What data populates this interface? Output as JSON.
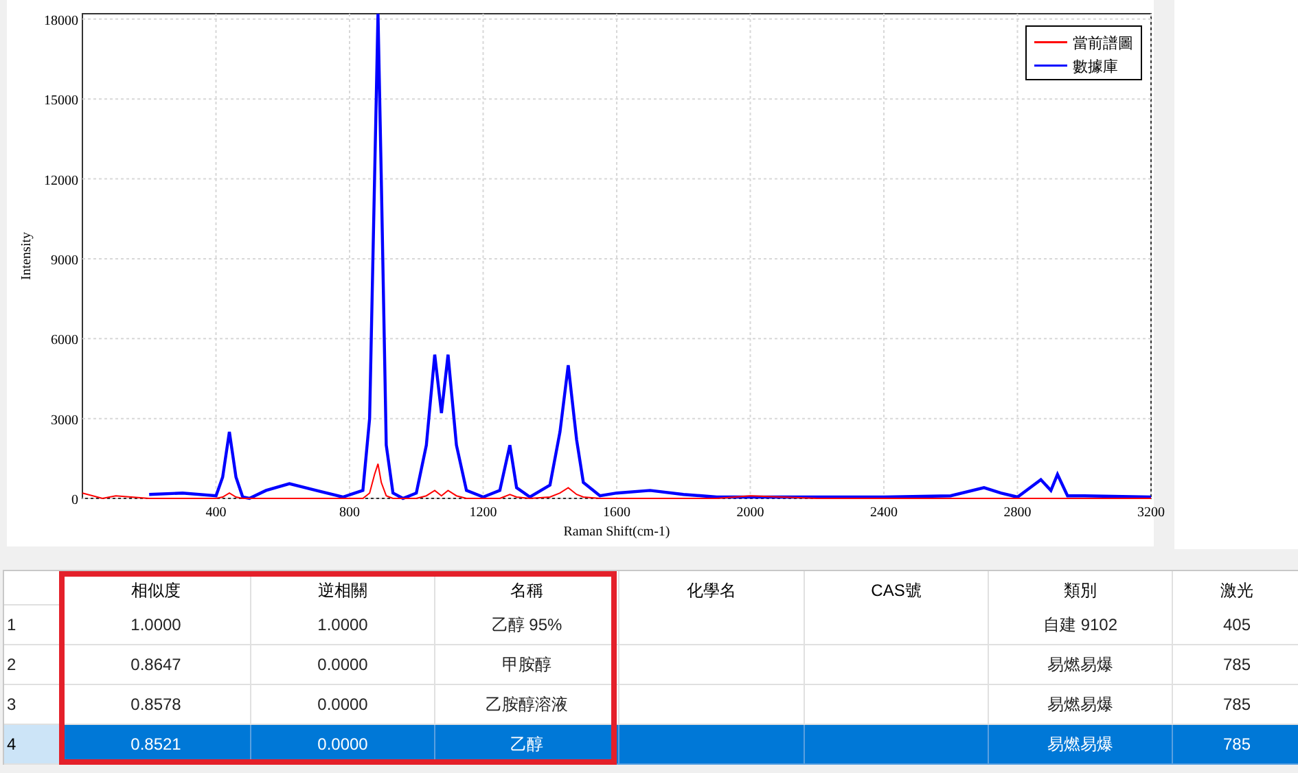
{
  "chart": {
    "chart_data": {
      "type": "line",
      "grid": true,
      "legend": true,
      "xlabel": "Raman Shift(cm-1)",
      "ylabel": "Intensity",
      "xlim": [
        0,
        3200
      ],
      "ylim": [
        0,
        18200
      ],
      "xticks": [
        400,
        800,
        1200,
        1600,
        2000,
        2400,
        2800,
        3200
      ],
      "yticks": [
        0,
        3000,
        6000,
        9000,
        12000,
        15000,
        18000
      ],
      "x": [
        0,
        60,
        100,
        200,
        300,
        400,
        420,
        440,
        460,
        480,
        500,
        550,
        620,
        700,
        780,
        840,
        860,
        875,
        885,
        895,
        910,
        930,
        960,
        1000,
        1030,
        1055,
        1075,
        1095,
        1120,
        1150,
        1200,
        1250,
        1280,
        1300,
        1340,
        1400,
        1430,
        1455,
        1480,
        1500,
        1550,
        1600,
        1700,
        1800,
        1900,
        2000,
        2200,
        2400,
        2600,
        2700,
        2750,
        2800,
        2870,
        2900,
        2920,
        2950,
        3000,
        3200
      ],
      "series": [
        {
          "name": "當前譜圖",
          "color": "#ff0000",
          "values": [
            200,
            0,
            100,
            0,
            0,
            0,
            50,
            200,
            50,
            0,
            0,
            0,
            0,
            0,
            0,
            0,
            200,
            900,
            1300,
            600,
            100,
            0,
            0,
            0,
            100,
            300,
            100,
            300,
            100,
            0,
            0,
            0,
            150,
            50,
            0,
            50,
            200,
            400,
            150,
            50,
            0,
            0,
            0,
            0,
            0,
            100,
            0,
            0,
            0,
            0,
            0,
            0,
            0,
            0,
            0,
            0,
            0,
            0
          ]
        },
        {
          "name": "數據庫",
          "color": "#0000ff",
          "values": [
            null,
            null,
            null,
            150,
            200,
            100,
            800,
            2500,
            800,
            50,
            0,
            300,
            550,
            300,
            50,
            300,
            3000,
            12000,
            18200,
            12000,
            2000,
            200,
            0,
            200,
            2000,
            5400,
            3200,
            5400,
            2000,
            300,
            50,
            300,
            2000,
            400,
            50,
            500,
            2500,
            5000,
            2200,
            600,
            100,
            200,
            300,
            150,
            50,
            50,
            50,
            50,
            100,
            400,
            200,
            50,
            700,
            300,
            900,
            100,
            100,
            50
          ]
        }
      ]
    }
  },
  "table": {
    "columns": [
      "相似度",
      "逆相關",
      "名稱",
      "化學名",
      "CAS號",
      "類別",
      "激光"
    ],
    "rows": [
      {
        "number": "1",
        "similarity": "1.0000",
        "inverse": "1.0000",
        "name": "乙醇 95%",
        "category": "自建 9102",
        "laser": "405",
        "selected": false
      },
      {
        "number": "2",
        "similarity": "0.8647",
        "inverse": "0.0000",
        "name": "甲胺醇",
        "category": "易燃易爆",
        "laser": "785",
        "selected": false
      },
      {
        "number": "3",
        "similarity": "0.8578",
        "inverse": "0.0000",
        "name": "乙胺醇溶液",
        "category": "易燃易爆",
        "laser": "785",
        "selected": false
      },
      {
        "number": "4",
        "similarity": "0.8521",
        "inverse": "0.0000",
        "name": "乙醇",
        "category": "易燃易爆",
        "laser": "785",
        "selected": true
      }
    ]
  }
}
